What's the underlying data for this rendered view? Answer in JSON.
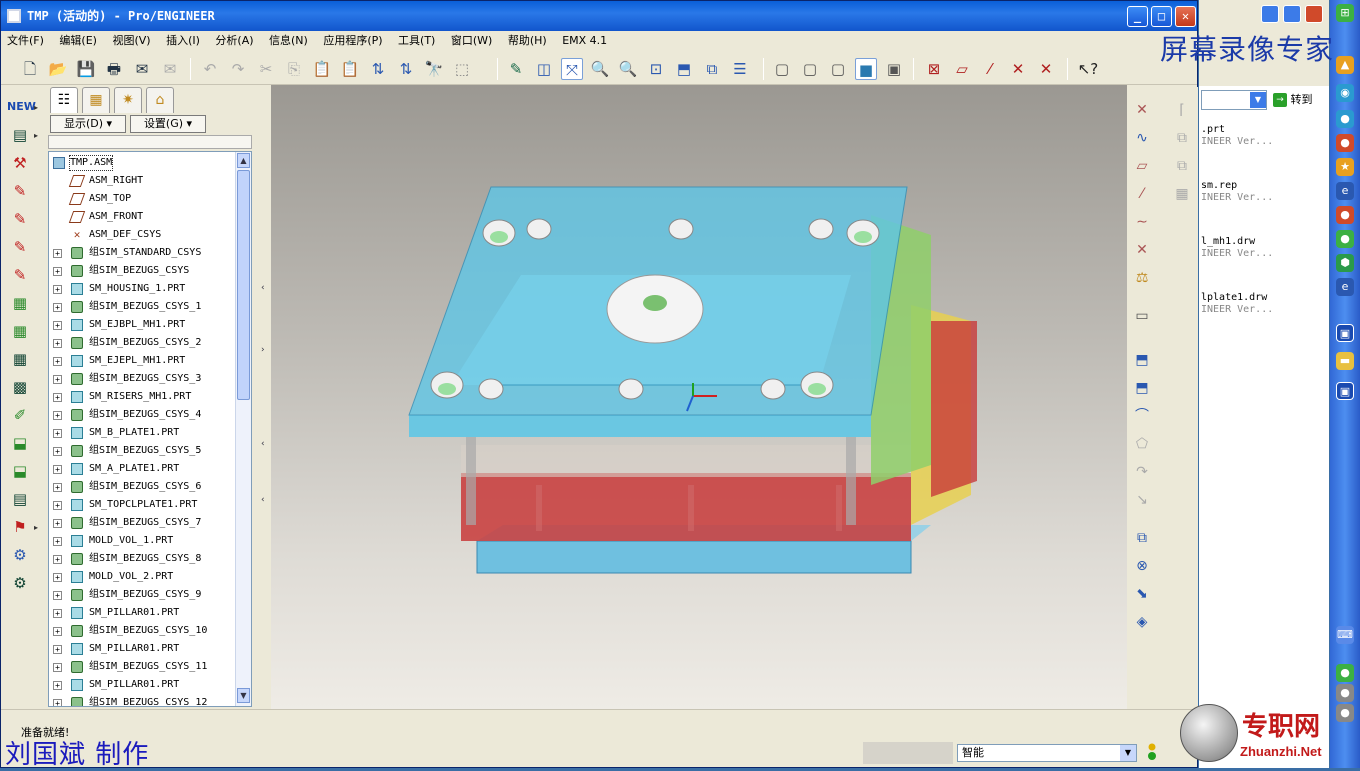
{
  "window": {
    "title": "TMP (活动的) - Pro/ENGINEER",
    "btn_min": "_",
    "btn_max": "□",
    "btn_close": "✕"
  },
  "menu": [
    "文件(F)",
    "编辑(E)",
    "视图(V)",
    "插入(I)",
    "分析(A)",
    "信息(N)",
    "应用程序(P)",
    "工具(T)",
    "窗口(W)",
    "帮助(H)",
    "EMX 4.1"
  ],
  "nav": {
    "show_label": "显示(D) ▾",
    "settings_label": "设置(G) ▾",
    "tree": [
      {
        "label": "TMP.ASM",
        "type": "asm",
        "expand": ""
      },
      {
        "label": "ASM_RIGHT",
        "type": "plane",
        "expand": ""
      },
      {
        "label": "ASM_TOP",
        "type": "plane",
        "expand": ""
      },
      {
        "label": "ASM_FRONT",
        "type": "plane",
        "expand": ""
      },
      {
        "label": "ASM_DEF_CSYS",
        "type": "dcsys",
        "expand": ""
      },
      {
        "label": "组SIM_STANDARD_CSYS",
        "type": "csys",
        "expand": "+"
      },
      {
        "label": "组SIM_BEZUGS_CSYS",
        "type": "csys",
        "expand": "+"
      },
      {
        "label": "SM_HOUSING_1.PRT",
        "type": "part",
        "expand": "+"
      },
      {
        "label": "组SIM_BEZUGS_CSYS_1",
        "type": "csys",
        "expand": "+"
      },
      {
        "label": "SM_EJBPL_MH1.PRT",
        "type": "part",
        "expand": "+"
      },
      {
        "label": "组SIM_BEZUGS_CSYS_2",
        "type": "csys",
        "expand": "+"
      },
      {
        "label": "SM_EJEPL_MH1.PRT",
        "type": "part",
        "expand": "+"
      },
      {
        "label": "组SIM_BEZUGS_CSYS_3",
        "type": "csys",
        "expand": "+"
      },
      {
        "label": "SM_RISERS_MH1.PRT",
        "type": "part",
        "expand": "+"
      },
      {
        "label": "组SIM_BEZUGS_CSYS_4",
        "type": "csys",
        "expand": "+"
      },
      {
        "label": "SM_B_PLATE1.PRT",
        "type": "part",
        "expand": "+"
      },
      {
        "label": "组SIM_BEZUGS_CSYS_5",
        "type": "csys",
        "expand": "+"
      },
      {
        "label": "SM_A_PLATE1.PRT",
        "type": "part",
        "expand": "+"
      },
      {
        "label": "组SIM_BEZUGS_CSYS_6",
        "type": "csys",
        "expand": "+"
      },
      {
        "label": "SM_TOPCLPLATE1.PRT",
        "type": "part",
        "expand": "+"
      },
      {
        "label": "组SIM_BEZUGS_CSYS_7",
        "type": "csys",
        "expand": "+"
      },
      {
        "label": "MOLD_VOL_1.PRT",
        "type": "part",
        "expand": "+"
      },
      {
        "label": "组SIM_BEZUGS_CSYS_8",
        "type": "csys",
        "expand": "+"
      },
      {
        "label": "MOLD_VOL_2.PRT",
        "type": "part",
        "expand": "+"
      },
      {
        "label": "组SIM_BEZUGS_CSYS_9",
        "type": "csys",
        "expand": "+"
      },
      {
        "label": "SM_PILLAR01.PRT",
        "type": "part",
        "expand": "+"
      },
      {
        "label": "组SIM_BEZUGS_CSYS_10",
        "type": "csys",
        "expand": "+"
      },
      {
        "label": "SM_PILLAR01.PRT",
        "type": "part",
        "expand": "+"
      },
      {
        "label": "组SIM_BEZUGS_CSYS_11",
        "type": "csys",
        "expand": "+"
      },
      {
        "label": "SM_PILLAR01.PRT",
        "type": "part",
        "expand": "+"
      },
      {
        "label": "组SIM_BEZUGS_CSYS_12",
        "type": "csys",
        "expand": "+"
      }
    ]
  },
  "status": {
    "message": "准备就绪!",
    "filter_value": "智能",
    "credit": "刘国斌 制作"
  },
  "background_window": {
    "goto_label": "转到",
    "files": [
      {
        "name": ".prt",
        "sub": "INEER Ver..."
      },
      {
        "name": "sm.rep",
        "sub": "INEER Ver..."
      },
      {
        "name": "l_mh1.drw",
        "sub": "INEER Ver..."
      },
      {
        "name": "lplate1.drw",
        "sub": "INEER Ver..."
      }
    ]
  },
  "overlays": {
    "watermark": "屏幕录像专家",
    "logo_cn": "专职网",
    "logo_en": "Zhuanzhi.Net"
  },
  "colors": {
    "titlebar": "#1155cc",
    "plate_blue": "#5fc6e6",
    "plate_red": "#c83a3a",
    "plate_green": "#8fcf6a",
    "plate_yellow": "#e8d050"
  }
}
